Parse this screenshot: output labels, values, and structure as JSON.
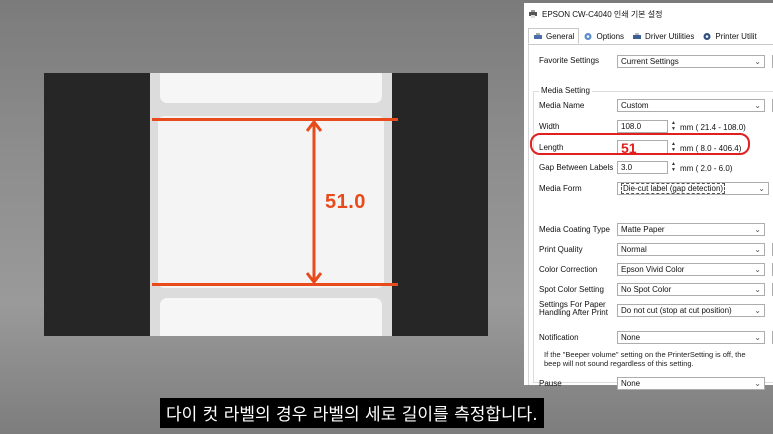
{
  "photo": {
    "measurement": "51.0",
    "accent_color": "#e84a1c"
  },
  "dialog": {
    "title": "EPSON CW-C4040 인쇄 기본 설정",
    "tabs": [
      {
        "label": "General",
        "icon": "printer-settings-icon"
      },
      {
        "label": "Options",
        "icon": "options-gear-icon"
      },
      {
        "label": "Driver Utilities",
        "icon": "driver-utilities-icon"
      },
      {
        "label": "Printer Utilit",
        "icon": "printer-utility-icon"
      }
    ],
    "favorite": {
      "label": "Favorite Settings",
      "value": "Current Settings"
    },
    "media_setting_title": "Media Setting",
    "media_name": {
      "label": "Media Name",
      "value": "Custom"
    },
    "width": {
      "label": "Width",
      "value": "108.0",
      "unit": "mm",
      "range": "( 21.4 - 108.0)"
    },
    "length": {
      "label": "Length",
      "value": "51",
      "unit": "mm",
      "range": "(  8.0 - 406.4)"
    },
    "gap": {
      "label": "Gap Between Labels",
      "value": "3.0",
      "unit": "mm",
      "range": "(  2.0 -   6.0)"
    },
    "media_form": {
      "label": "Media Form",
      "value": "Die-cut label (gap detection)"
    },
    "media_coating": {
      "label": "Media Coating Type",
      "value": "Matte Paper"
    },
    "print_quality": {
      "label": "Print Quality",
      "value": "Normal"
    },
    "color_correction": {
      "label": "Color Correction",
      "value": "Epson Vivid Color"
    },
    "spot_color": {
      "label": "Spot Color Setting",
      "value": "No Spot Color"
    },
    "paper_handling": {
      "label": "Settings For Paper Handling After Print",
      "value": "Do not cut (stop at cut position)"
    },
    "notification": {
      "label": "Notification",
      "value": "None"
    },
    "note": "If the \"Beeper volume\" setting on the PrinterSetting is off, the beep will not sound regardless of this setting.",
    "pause": {
      "label": "Pause",
      "value": "None"
    }
  },
  "subtitle": "다이 컷 라벨의 경우 라벨의 세로 길이를 측정합니다."
}
